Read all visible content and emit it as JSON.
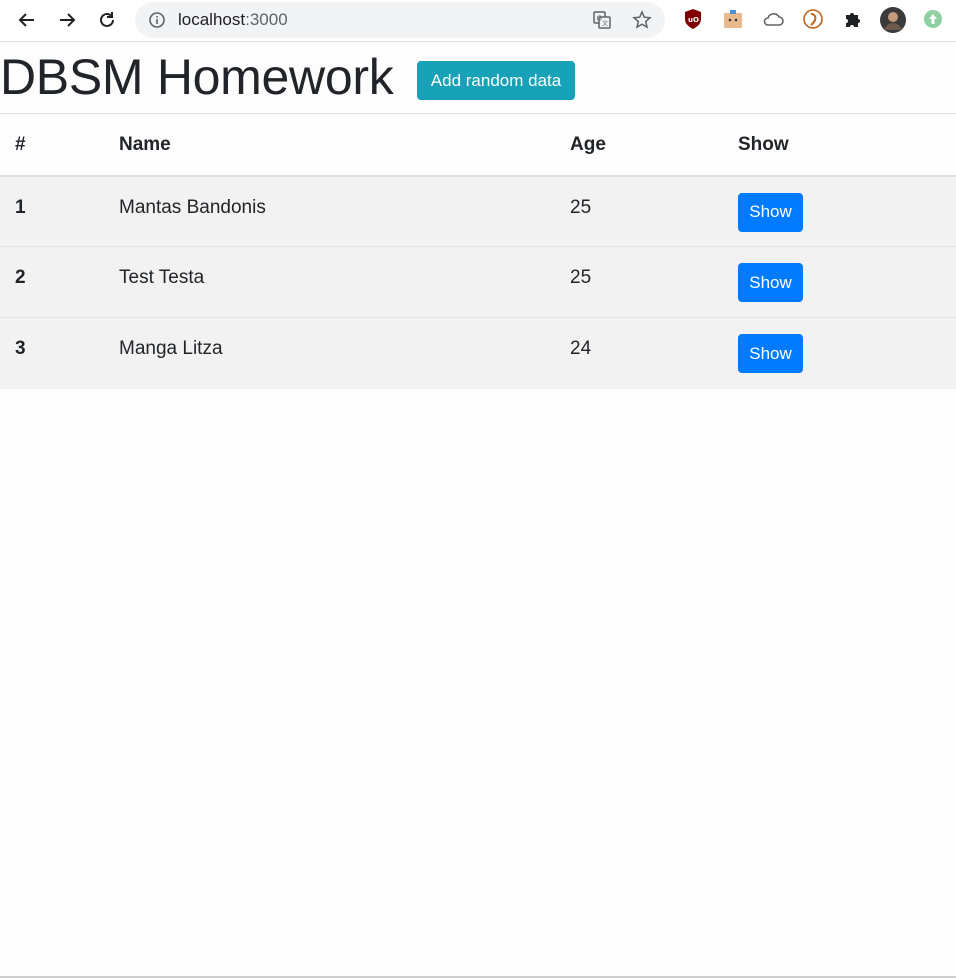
{
  "browser": {
    "url_host": "localhost",
    "url_port": ":3000",
    "icons": {
      "back": "arrow-left-icon",
      "forward": "arrow-right-icon",
      "reload": "reload-icon",
      "site_info": "info-icon",
      "translate": "translate-icon",
      "bookmark": "star-icon",
      "extensions": [
        "ublock-icon",
        "extension-box-icon",
        "cloud-icon",
        "extension-c-icon",
        "puzzle-icon",
        "profile-avatar",
        "extension-up-icon"
      ]
    }
  },
  "page": {
    "title": "DBSM Homework",
    "add_button_label": "Add random data",
    "accent_color": "#17a2b8",
    "primary_color": "#007bff"
  },
  "table": {
    "headers": [
      "#",
      "Name",
      "Age",
      "Show"
    ],
    "rows": [
      {
        "id": "1",
        "name": "Mantas Bandonis",
        "age": "25",
        "action": "Show"
      },
      {
        "id": "2",
        "name": "Test Testa",
        "age": "25",
        "action": "Show"
      },
      {
        "id": "3",
        "name": "Manga Litza",
        "age": "24",
        "action": "Show"
      }
    ]
  }
}
